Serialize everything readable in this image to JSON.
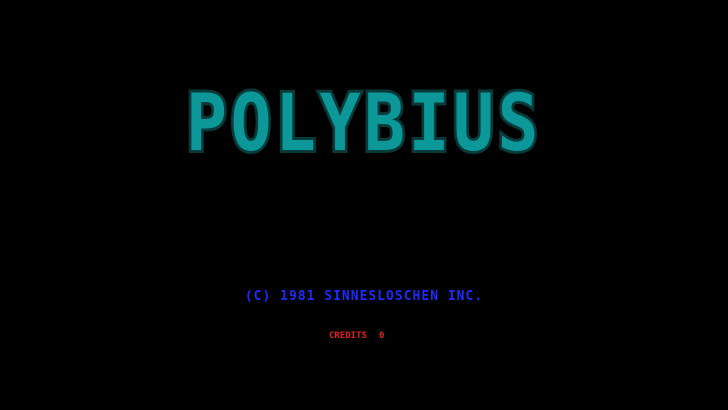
{
  "game": {
    "title": "POLYBIUS",
    "copyright": "(C) 1981 SINNESLOSCHEN INC.",
    "credits_label": "CREDITS",
    "credits_value": "0"
  },
  "colors": {
    "background": "#000000",
    "title_fill": "#0c9898",
    "title_outline": "#083a3a",
    "copyright": "#1a2cff",
    "credits": "#e0201c"
  }
}
